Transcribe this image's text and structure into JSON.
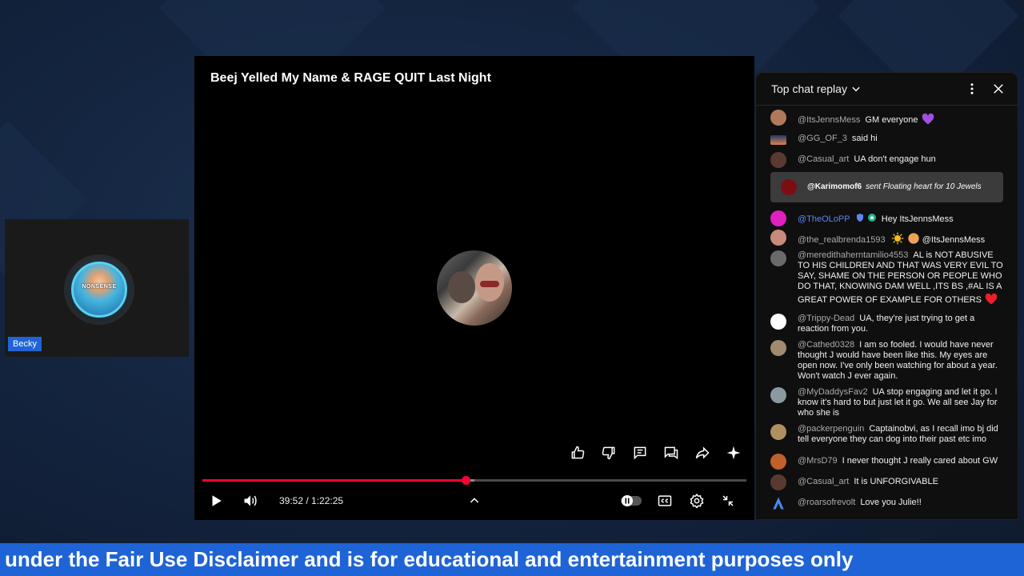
{
  "webcam": {
    "name": "Becky",
    "avatar_text": "NONSENSE"
  },
  "video": {
    "title": "Beej Yelled My Name & RAGE QUIT Last Night",
    "current_time": "39:52",
    "duration": "1:22:25",
    "time_separator": " / ",
    "progress_fraction": 0.484,
    "buffered_fraction": 0.5,
    "actions": [
      "like-icon",
      "dislike-icon",
      "comment-icon",
      "chat-bubble-icon",
      "share-icon",
      "sparkle-icon"
    ],
    "controls": [
      "play-icon",
      "volume-icon",
      "chevron-up-icon",
      "autoplay-toggle",
      "captions-icon",
      "settings-icon",
      "exit-fullscreen-icon"
    ],
    "colors": {
      "progress": "#ff0033"
    }
  },
  "chat": {
    "mode_label": "Top chat replay",
    "messages": [
      {
        "author": "@ItsJennsMess",
        "text": "GM everyone",
        "emoji": "purple-heart"
      },
      {
        "author": "@GG_OF_3",
        "text": "said hi"
      },
      {
        "author": "@Casual_art",
        "text": "UA don't engage hun"
      },
      {
        "author": "@TheOLoPP",
        "text": "Hey ItsJennsMess",
        "moderator": true
      },
      {
        "author": "@the_realbrenda1593",
        "text": "@ItsJennsMess",
        "emoji": "sun-face"
      },
      {
        "author": "@meredithaherntamilio4553",
        "text": "AL is NOT ABUSIVE TO HIS CHILDREN AND THAT WAS VERY EVIL TO SAY, SHAME ON THE PERSON OR PEOPLE WHO DO THAT, KNOWING DAM WELL ,ITS BS ,#AL IS A GREAT POWER OF EXAMPLE FOR OTHERS",
        "emoji": "red-heart"
      },
      {
        "author": "@Trippy-Dead",
        "text": "UA, they're just trying to get a reaction from you."
      },
      {
        "author": "@Cathed0328",
        "text": "I am so fooled. I would have never thought J would have been like this. My eyes are open now. I've only been watching for about a year. Won't watch J ever again."
      },
      {
        "author": "@MyDaddysFav2",
        "text": "UA stop engaging and let it go. I know it's hard to but just let it go. We all see Jay for who she is"
      },
      {
        "author": "@packerpenguin",
        "text": "Captainobvi, as I recall imo bj did tell everyone they can dog into their past etc imo"
      },
      {
        "author": "@MrsD79",
        "text": "I never thought J really cared about GW"
      },
      {
        "author": "@Casual_art",
        "text": "It is UNFORGIVABLE"
      },
      {
        "author": "@roarsofrevolt",
        "text": "Love you Julie!!"
      }
    ],
    "gift": {
      "author": "@Karimomof6",
      "text": "sent Floating heart for 10 Jewels"
    }
  },
  "banner": {
    "text": "under the Fair Use Disclaimer and is for educational and entertainment purposes only"
  }
}
